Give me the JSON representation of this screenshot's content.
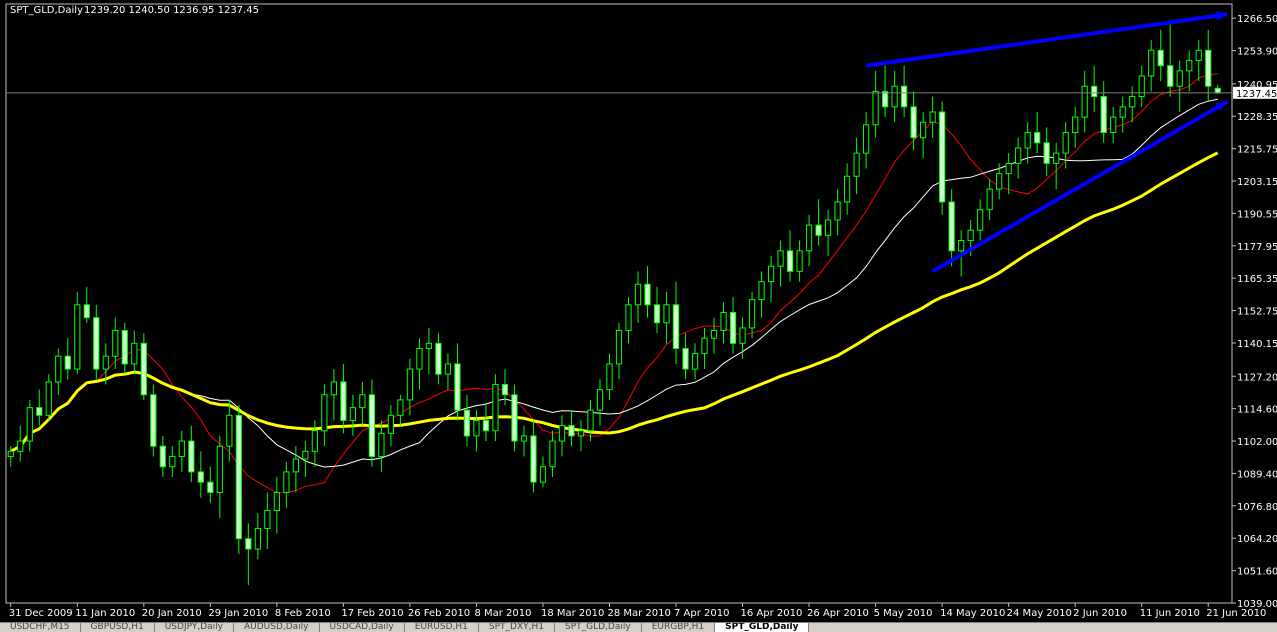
{
  "chart_data": {
    "type": "candlestick",
    "title": "SPT_GLD,Daily",
    "ohlc_header": "1239.20 1240.50 1236.95 1237.45",
    "current_price_label": "1237.45",
    "ylim": [
      1039.0,
      1272.0
    ],
    "y_ticks": [
      "1266.50",
      "1253.90",
      "1240.95",
      "1228.35",
      "1215.75",
      "1203.15",
      "1190.55",
      "1177.95",
      "1165.35",
      "1152.75",
      "1140.15",
      "1127.20",
      "1114.60",
      "1102.00",
      "1089.40",
      "1076.80",
      "1064.20",
      "1051.60",
      "1039.00"
    ],
    "x_labels": [
      "31 Dec 2009",
      "11 Jan 2010",
      "20 Jan 2010",
      "29 Jan 2010",
      "8 Feb 2010",
      "17 Feb 2010",
      "26 Feb 2010",
      "8 Mar 2010",
      "18 Mar 2010",
      "28 Mar 2010",
      "7 Apr 2010",
      "16 Apr 2010",
      "26 Apr 2010",
      "5 May 2010",
      "14 May 2010",
      "24 May 2010",
      "2 Jun 2010",
      "11 Jun 2010",
      "21 Jun 2010"
    ],
    "x_label_bars": [
      0,
      7,
      14,
      21,
      28,
      35,
      42,
      49,
      56,
      63,
      70,
      77,
      84,
      91,
      98,
      105,
      112,
      119,
      126
    ],
    "bars": [
      [
        1096,
        1100,
        1092,
        1098
      ],
      [
        1098,
        1108,
        1094,
        1102
      ],
      [
        1102,
        1118,
        1098,
        1115
      ],
      [
        1115,
        1122,
        1108,
        1112
      ],
      [
        1112,
        1128,
        1110,
        1125
      ],
      [
        1125,
        1138,
        1120,
        1135
      ],
      [
        1135,
        1142,
        1126,
        1130
      ],
      [
        1130,
        1160,
        1128,
        1155
      ],
      [
        1155,
        1162,
        1148,
        1150
      ],
      [
        1150,
        1155,
        1126,
        1130
      ],
      [
        1130,
        1140,
        1124,
        1135
      ],
      [
        1135,
        1150,
        1130,
        1145
      ],
      [
        1145,
        1148,
        1128,
        1132
      ],
      [
        1132,
        1145,
        1128,
        1140
      ],
      [
        1140,
        1144,
        1118,
        1120
      ],
      [
        1120,
        1124,
        1096,
        1100
      ],
      [
        1100,
        1104,
        1088,
        1092
      ],
      [
        1092,
        1100,
        1088,
        1096
      ],
      [
        1096,
        1106,
        1090,
        1102
      ],
      [
        1102,
        1108,
        1086,
        1090
      ],
      [
        1090,
        1098,
        1080,
        1086
      ],
      [
        1086,
        1092,
        1078,
        1082
      ],
      [
        1082,
        1104,
        1072,
        1100
      ],
      [
        1100,
        1118,
        1094,
        1112
      ],
      [
        1112,
        1116,
        1058,
        1064
      ],
      [
        1064,
        1070,
        1046,
        1060
      ],
      [
        1060,
        1074,
        1056,
        1068
      ],
      [
        1068,
        1082,
        1060,
        1075
      ],
      [
        1075,
        1088,
        1066,
        1082
      ],
      [
        1082,
        1094,
        1076,
        1090
      ],
      [
        1090,
        1100,
        1082,
        1095
      ],
      [
        1095,
        1102,
        1088,
        1098
      ],
      [
        1098,
        1110,
        1092,
        1106
      ],
      [
        1106,
        1124,
        1100,
        1120
      ],
      [
        1120,
        1130,
        1110,
        1125
      ],
      [
        1125,
        1132,
        1105,
        1110
      ],
      [
        1110,
        1120,
        1104,
        1115
      ],
      [
        1115,
        1125,
        1108,
        1120
      ],
      [
        1120,
        1126,
        1092,
        1096
      ],
      [
        1096,
        1110,
        1090,
        1105
      ],
      [
        1105,
        1116,
        1100,
        1112
      ],
      [
        1112,
        1120,
        1108,
        1118
      ],
      [
        1118,
        1134,
        1112,
        1130
      ],
      [
        1130,
        1142,
        1122,
        1138
      ],
      [
        1138,
        1146,
        1128,
        1140
      ],
      [
        1140,
        1144,
        1124,
        1128
      ],
      [
        1128,
        1136,
        1122,
        1132
      ],
      [
        1132,
        1140,
        1110,
        1114
      ],
      [
        1114,
        1120,
        1100,
        1104
      ],
      [
        1104,
        1114,
        1098,
        1110
      ],
      [
        1110,
        1116,
        1102,
        1106
      ],
      [
        1106,
        1128,
        1102,
        1124
      ],
      [
        1124,
        1130,
        1116,
        1120
      ],
      [
        1120,
        1124,
        1098,
        1102
      ],
      [
        1102,
        1108,
        1096,
        1104
      ],
      [
        1104,
        1110,
        1082,
        1086
      ],
      [
        1086,
        1096,
        1084,
        1092
      ],
      [
        1092,
        1106,
        1088,
        1102
      ],
      [
        1102,
        1112,
        1096,
        1108
      ],
      [
        1108,
        1114,
        1100,
        1104
      ],
      [
        1104,
        1110,
        1098,
        1106
      ],
      [
        1106,
        1118,
        1102,
        1114
      ],
      [
        1114,
        1126,
        1108,
        1122
      ],
      [
        1122,
        1136,
        1118,
        1132
      ],
      [
        1132,
        1148,
        1126,
        1145
      ],
      [
        1145,
        1158,
        1140,
        1155
      ],
      [
        1155,
        1168,
        1148,
        1163
      ],
      [
        1163,
        1170,
        1150,
        1155
      ],
      [
        1155,
        1162,
        1144,
        1148
      ],
      [
        1148,
        1160,
        1140,
        1155
      ],
      [
        1155,
        1164,
        1132,
        1138
      ],
      [
        1138,
        1144,
        1126,
        1130
      ],
      [
        1130,
        1140,
        1126,
        1136
      ],
      [
        1136,
        1146,
        1130,
        1142
      ],
      [
        1142,
        1150,
        1136,
        1145
      ],
      [
        1145,
        1156,
        1140,
        1152
      ],
      [
        1152,
        1158,
        1136,
        1140
      ],
      [
        1140,
        1150,
        1134,
        1146
      ],
      [
        1146,
        1160,
        1142,
        1157
      ],
      [
        1157,
        1168,
        1150,
        1164
      ],
      [
        1164,
        1174,
        1156,
        1170
      ],
      [
        1170,
        1180,
        1162,
        1176
      ],
      [
        1176,
        1184,
        1164,
        1168
      ],
      [
        1168,
        1180,
        1164,
        1176
      ],
      [
        1176,
        1190,
        1170,
        1186
      ],
      [
        1186,
        1196,
        1178,
        1182
      ],
      [
        1182,
        1192,
        1174,
        1188
      ],
      [
        1188,
        1200,
        1182,
        1195
      ],
      [
        1195,
        1210,
        1190,
        1205
      ],
      [
        1205,
        1220,
        1198,
        1214
      ],
      [
        1214,
        1230,
        1208,
        1225
      ],
      [
        1225,
        1246,
        1220,
        1238
      ],
      [
        1238,
        1248,
        1228,
        1232
      ],
      [
        1232,
        1246,
        1226,
        1240
      ],
      [
        1240,
        1248,
        1228,
        1232
      ],
      [
        1232,
        1238,
        1215,
        1220
      ],
      [
        1220,
        1230,
        1212,
        1226
      ],
      [
        1226,
        1236,
        1220,
        1230
      ],
      [
        1230,
        1234,
        1190,
        1195
      ],
      [
        1195,
        1200,
        1170,
        1176
      ],
      [
        1176,
        1184,
        1166,
        1180
      ],
      [
        1180,
        1188,
        1174,
        1184
      ],
      [
        1184,
        1196,
        1180,
        1192
      ],
      [
        1192,
        1204,
        1188,
        1200
      ],
      [
        1200,
        1210,
        1196,
        1206
      ],
      [
        1206,
        1214,
        1198,
        1210
      ],
      [
        1210,
        1220,
        1204,
        1216
      ],
      [
        1216,
        1226,
        1210,
        1222
      ],
      [
        1222,
        1230,
        1214,
        1218
      ],
      [
        1218,
        1224,
        1205,
        1210
      ],
      [
        1210,
        1218,
        1200,
        1214
      ],
      [
        1214,
        1226,
        1208,
        1222
      ],
      [
        1222,
        1232,
        1216,
        1228
      ],
      [
        1228,
        1246,
        1222,
        1240
      ],
      [
        1240,
        1248,
        1230,
        1236
      ],
      [
        1236,
        1242,
        1218,
        1222
      ],
      [
        1222,
        1232,
        1218,
        1228
      ],
      [
        1228,
        1236,
        1222,
        1232
      ],
      [
        1232,
        1240,
        1226,
        1236
      ],
      [
        1236,
        1248,
        1232,
        1244
      ],
      [
        1244,
        1258,
        1238,
        1254
      ],
      [
        1254,
        1262,
        1242,
        1248
      ],
      [
        1248,
        1264,
        1236,
        1240
      ],
      [
        1240,
        1250,
        1230,
        1246
      ],
      [
        1246,
        1254,
        1238,
        1250
      ],
      [
        1250,
        1258,
        1242,
        1254
      ],
      [
        1254,
        1262,
        1234,
        1240
      ],
      [
        1239.2,
        1240.5,
        1236.95,
        1237.45
      ]
    ],
    "moving_averages": [
      {
        "color": "#ff0000",
        "period": 10
      },
      {
        "color": "#ffffff",
        "period": 20
      },
      {
        "color": "#ffff00",
        "period": 50
      }
    ],
    "trendlines": [
      {
        "color": "#0000ff",
        "from": [
          90,
          1248
        ],
        "to": [
          128,
          1268
        ]
      },
      {
        "color": "#0000ff",
        "from": [
          97,
          1168
        ],
        "to": [
          128,
          1234
        ]
      }
    ],
    "colors": {
      "background": "#000000",
      "bull_body": "#000000",
      "bear_body": "#ccffcc",
      "wick": "#00ff00",
      "grid": "#808080"
    }
  },
  "tabs": [
    {
      "label": "USDCHF,M15",
      "active": false
    },
    {
      "label": "GBPUSD,H1",
      "active": false
    },
    {
      "label": "USDJPY,Daily",
      "active": false
    },
    {
      "label": "AUDUSD,Daily",
      "active": false
    },
    {
      "label": "USDCAD,Daily",
      "active": false
    },
    {
      "label": "EURUSD,H1",
      "active": false
    },
    {
      "label": "SPT_DXY,H1",
      "active": false
    },
    {
      "label": "SPT_GLD,Daily",
      "active": false
    },
    {
      "label": "EURGBP,H1",
      "active": false
    },
    {
      "label": "SPT_GLD,Daily",
      "active": true
    }
  ]
}
